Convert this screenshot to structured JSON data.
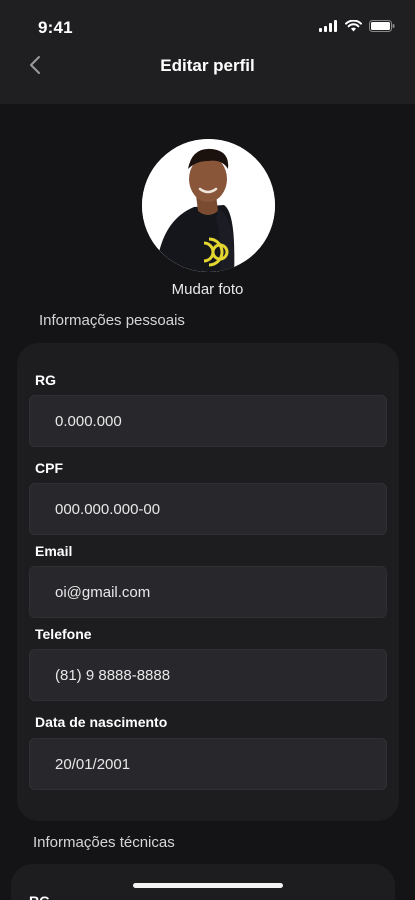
{
  "status_bar": {
    "time": "9:41",
    "signal_icon": "cellular-signal-icon",
    "wifi_icon": "wifi-icon",
    "battery_icon": "battery-icon"
  },
  "header": {
    "title": "Editar perfil",
    "back_icon": "chevron-left-icon"
  },
  "profile": {
    "change_photo_label": "Mudar foto"
  },
  "personal_info": {
    "title": "Informações pessoais",
    "fields": [
      {
        "label": "RG",
        "value": "0.000.000"
      },
      {
        "label": "CPF",
        "value": "000.000.000-00"
      },
      {
        "label": "Email",
        "value": "oi@gmail.com"
      },
      {
        "label": "Telefone",
        "value": "(81) 9 8888-8888"
      },
      {
        "label": "Data de nascimento",
        "value": "20/01/2001"
      }
    ]
  },
  "technical_info": {
    "title": "Informações técnicas",
    "first_field_label": "RG"
  },
  "colors": {
    "background": "#141416",
    "card": "#1d1d20",
    "input": "#28282c",
    "accent_logo": "#e3d630"
  }
}
